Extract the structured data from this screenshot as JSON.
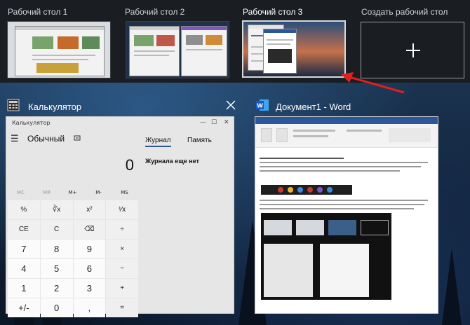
{
  "desktops": [
    {
      "label": "Рабочий стол 1"
    },
    {
      "label": "Рабочий стол 2"
    },
    {
      "label": "Рабочий стол 3"
    },
    {
      "label": "Создать рабочий стол"
    }
  ],
  "windows": {
    "calculator": {
      "title": "Калькулятор",
      "inner_title": "Калькулятор",
      "mode": "Обычный",
      "display": "0",
      "tabs": [
        "Журнал",
        "Память"
      ],
      "history_empty": "Журнала еще нет",
      "memory": [
        "MC",
        "MR",
        "M+",
        "M-",
        "MS"
      ],
      "keys": [
        [
          "%",
          "∛x",
          "x²",
          "¹⁄x"
        ],
        [
          "CE",
          "C",
          "⌫",
          "÷"
        ],
        [
          "7",
          "8",
          "9",
          "×"
        ],
        [
          "4",
          "5",
          "6",
          "−"
        ],
        [
          "1",
          "2",
          "3",
          "+"
        ],
        [
          "+/-",
          "0",
          ",",
          "="
        ]
      ]
    },
    "word": {
      "title": "Документ1 - Word"
    }
  },
  "colors": {
    "topbar": "#1a1d22",
    "word_blue": "#2b579a",
    "arrow": "#e0201b"
  }
}
